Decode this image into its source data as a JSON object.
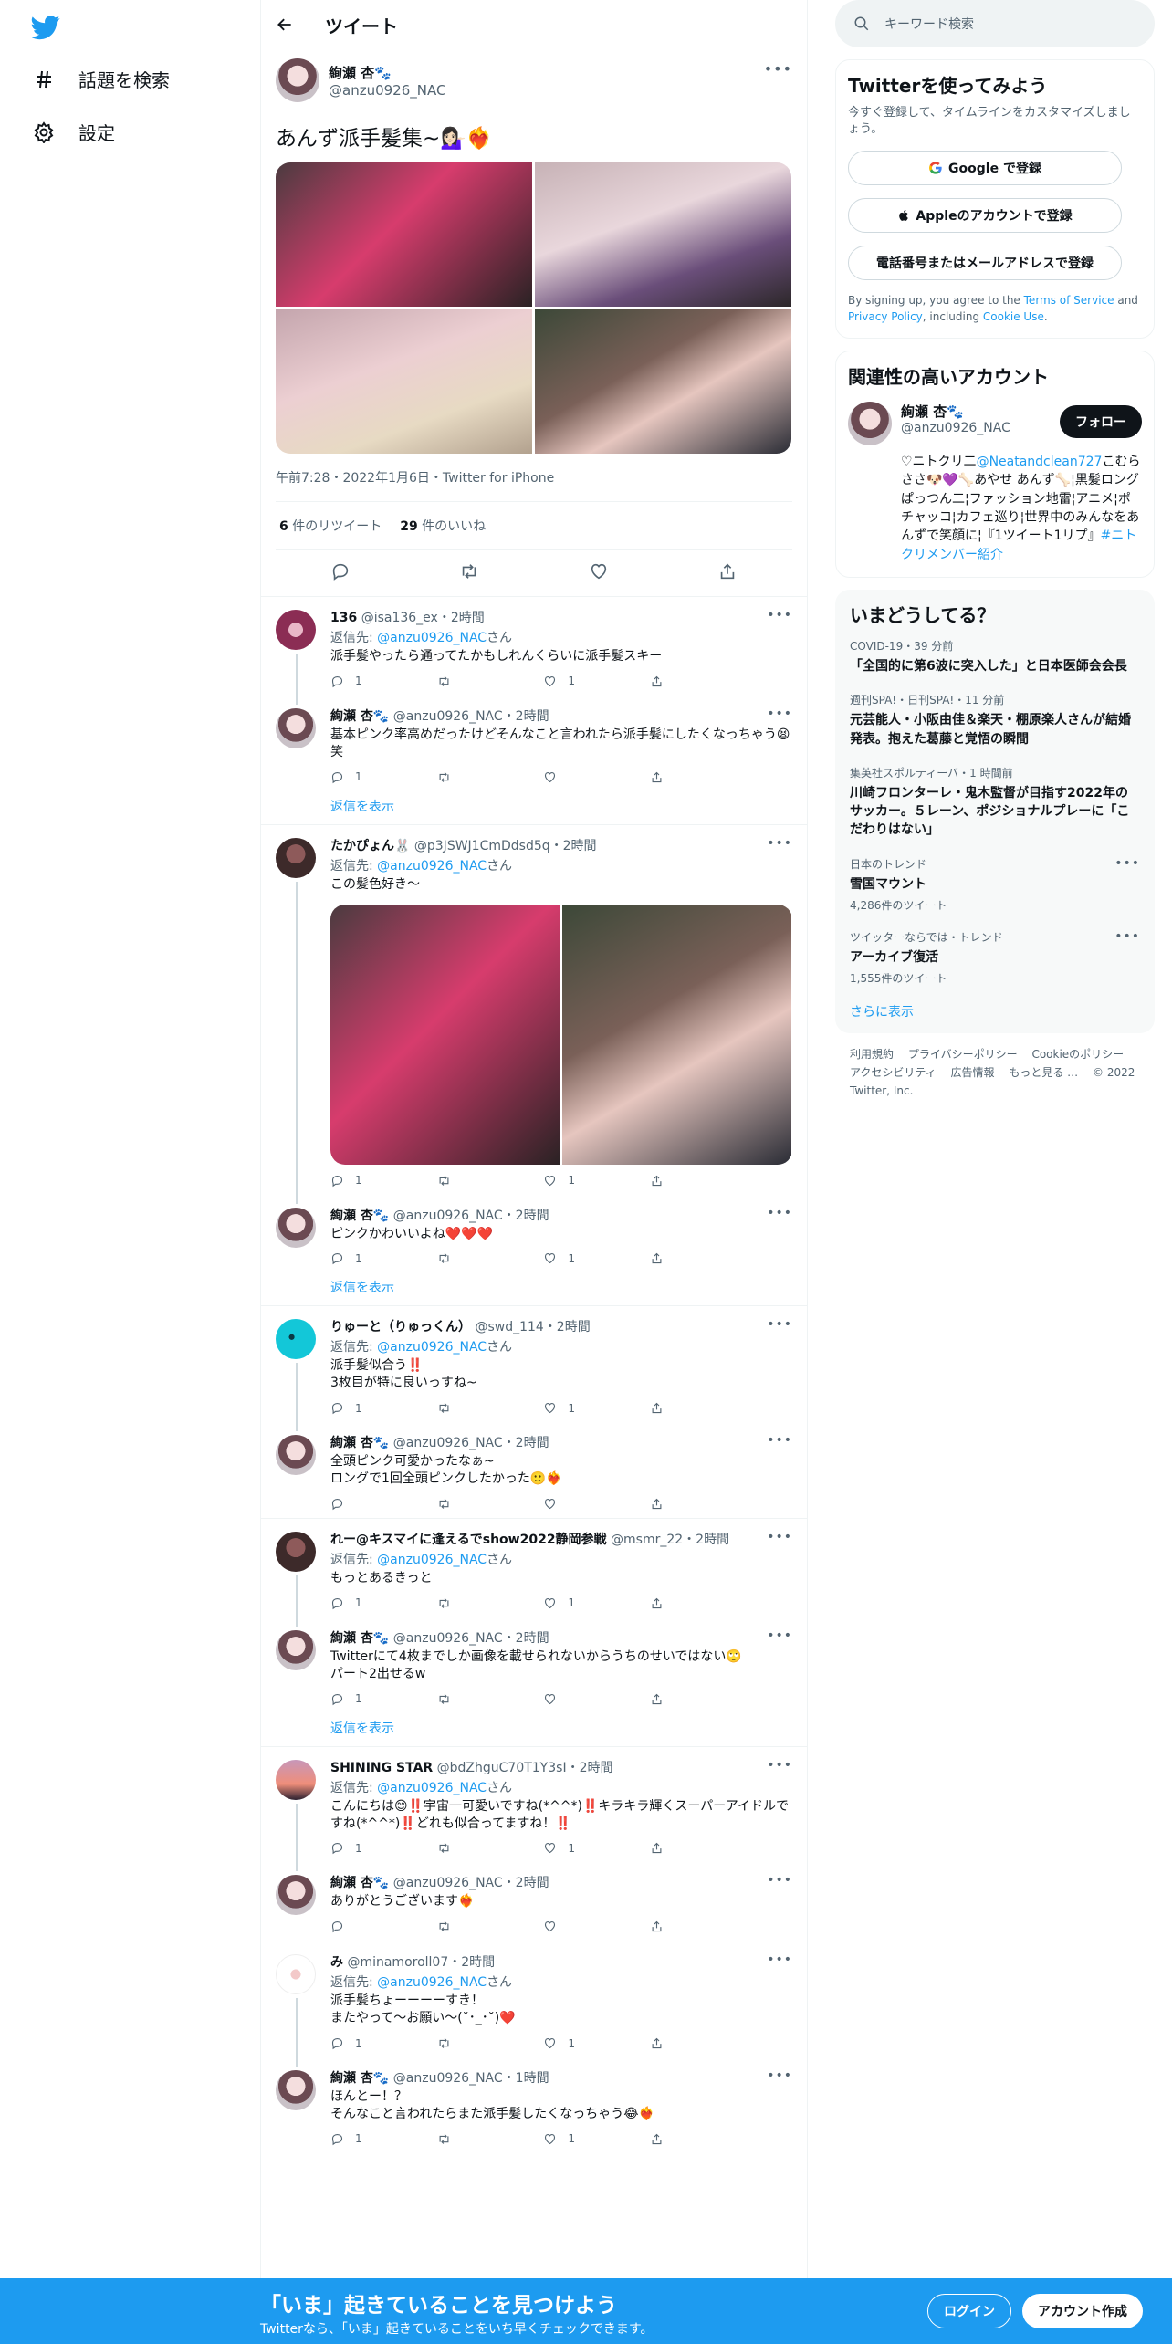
{
  "nav": {
    "explore": "話題を検索",
    "settings": "設定"
  },
  "header": {
    "title": "ツイート"
  },
  "main_tweet": {
    "name": "絢瀬 杏🐾",
    "handle": "@anzu0926_NAC",
    "text": "あんず派手髪集~💁🏻‍♀️❤️‍🔥",
    "meta": "午前7:28・2022年1月6日・Twitter for iPhone",
    "retweets_count": "6",
    "retweets_label": "件のリツイート",
    "likes_count": "29",
    "likes_label": "件のいいね"
  },
  "replies": [
    {
      "name": "136",
      "handle": "@isa136_ex",
      "time": "・2時間",
      "replyto_prefix": "返信先: ",
      "replyto": "@anzu0926_NAC",
      "replyto_suffix": "さん",
      "text": "派手髪やったら通ってたかもしれんくらいに派手髪スキー",
      "rt": "",
      "reply": "1",
      "like": "1"
    },
    {
      "name": "絢瀬 杏🐾",
      "handle": "@anzu0926_NAC",
      "time": "・2時間",
      "text": "基本ピンク率高めだったけどそんなこと言われたら派手髪にしたくなっちゃう😫笑",
      "reply": "1",
      "like": ""
    },
    {
      "name": "たかぴょん🐰",
      "handle": "@p3JSWJ1CmDdsd5q",
      "time": "・2時間",
      "replyto_prefix": "返信先: ",
      "replyto": "@anzu0926_NAC",
      "replyto_suffix": "さん",
      "text": "この髪色好き〜",
      "reply": "1",
      "like": "1"
    },
    {
      "name": "絢瀬 杏🐾",
      "handle": "@anzu0926_NAC",
      "time": "・2時間",
      "text": "ピンクかわいいよね❤️❤️❤️",
      "reply": "1",
      "like": "1"
    },
    {
      "name": "りゅーと（りゅっくん）",
      "handle": "@swd_114",
      "time": "・2時間",
      "replyto_prefix": "返信先: ",
      "replyto": "@anzu0926_NAC",
      "replyto_suffix": "さん",
      "text": "派手髪似合う‼️\n3枚目が特に良いっすね~",
      "reply": "1",
      "like": "1"
    },
    {
      "name": "絢瀬 杏🐾",
      "handle": "@anzu0926_NAC",
      "time": "・2時間",
      "text": "全頭ピンク可愛かったなぁ~\nロングで1回全頭ピンクしたかった🙂❤️‍🔥",
      "reply": "",
      "like": ""
    },
    {
      "name": "れー@キスマイに逢えるでshow2022静岡参戦",
      "handle": "@msmr_22",
      "time": "・2時間",
      "replyto_prefix": "返信先: ",
      "replyto": "@anzu0926_NAC",
      "replyto_suffix": "さん",
      "text": "もっとあるきっと",
      "reply": "1",
      "like": "1"
    },
    {
      "name": "絢瀬 杏🐾",
      "handle": "@anzu0926_NAC",
      "time": "・2時間",
      "text": "Twitterにて4枚までしか画像を載せられないからうちのせいではない🙄\nパート2出せるw",
      "reply": "1",
      "like": ""
    },
    {
      "name": "SHINING STAR",
      "handle": "@bdZhguC70T1Y3sI",
      "time": "・2時間",
      "replyto_prefix": "返信先: ",
      "replyto": "@anzu0926_NAC",
      "replyto_suffix": "さん",
      "text": "こんにちは😊‼️宇宙一可愛いですね(*^^*)‼️キラキラ輝くスーパーアイドルですね(*^^*)‼️どれも似合ってますね！‼️",
      "reply": "1",
      "like": "1"
    },
    {
      "name": "絢瀬 杏🐾",
      "handle": "@anzu0926_NAC",
      "time": "・2時間",
      "text": "ありがとうございます❤️‍🔥",
      "reply": "",
      "like": ""
    },
    {
      "name": "み",
      "handle": "@minamoroll07",
      "time": "・2時間",
      "replyto_prefix": "返信先: ",
      "replyto": "@anzu0926_NAC",
      "replyto_suffix": "さん",
      "text": "派手髪ちょーーーーすき！\nまたやって〜お願い〜(˘･_･˘)❤️",
      "reply": "1",
      "like": "1"
    },
    {
      "name": "絢瀬 杏🐾",
      "handle": "@anzu0926_NAC",
      "time": "・1時間",
      "text": "ほんとー！？\nそんなこと言われたらまた派手髪したくなっちゃう😂❤️‍🔥",
      "reply": "1",
      "like": "1"
    }
  ],
  "show_replies": "返信を表示",
  "right": {
    "search_placeholder": "キーワード検索",
    "signup_title": "Twitterを使ってみよう",
    "signup_sub": "今すぐ登録して、タイムラインをカスタマイズしましょう。",
    "google_btn": "Google で登録",
    "apple_btn": "Appleのアカウントで登録",
    "phone_btn": "電話番号またはメールアドレスで登録",
    "legal_1": "By signing up, you agree to the ",
    "legal_terms": "Terms of Service",
    "legal_2": " and ",
    "legal_privacy": "Privacy Policy",
    "legal_3": ", including ",
    "legal_cookie": "Cookie Use",
    "legal_4": ".",
    "related_title": "関連性の高いアカウント",
    "related_name": "絢瀬 杏🐾",
    "related_handle": "@anzu0926_NAC",
    "follow": "フォロー",
    "bio_1": "♡ニトクリ二",
    "bio_link": "@Neatandclean727",
    "bio_2": "こむらささ🐶💜🦴あやせ あんず🦴¦黒髪ロングぱっつん二¦ファッション地雷¦アニメ¦ポチャッコ¦カフェ巡り¦世界中のみんなをあんずで笑顔に¦『1ツイート1リプ』",
    "bio_tag": "#ニトクリメンバー紹介",
    "trends_title": "いまどうしてる？",
    "trends": [
      {
        "src": "COVID-19・39 分前",
        "title": "「全国的に第6波に突入した」と日本医師会会長"
      },
      {
        "src": "週刊SPA!・日刊SPA!・11 分前",
        "title": "元芸能人・小阪由佳＆楽天・棚原楽人さんが結婚発表。抱えた葛藤と覚悟の瞬間"
      },
      {
        "src": "集英社スポルティーバ・1 時間前",
        "title": "川崎フロンターレ・鬼木監督が目指す2022年のサッカー。５レーン、ポジショナルプレーに「こだわりはない」"
      },
      {
        "src": "日本のトレンド",
        "title": "雪国マウント",
        "count": "4,286件のツイート"
      },
      {
        "src": "ツイッターならでは・トレンド",
        "title": "アーカイブ復活",
        "count": "1,555件のツイート"
      }
    ],
    "show_more": "さらに表示",
    "footer": [
      "利用規約",
      "プライバシーポリシー",
      "Cookieのポリシー",
      "アクセシビリティ",
      "広告情報",
      "もっと見る …",
      "© 2022 Twitter, Inc."
    ]
  },
  "bottom": {
    "title": "「いま」起きていることを見つけよう",
    "sub": "Twitterなら、「いま」起きていることをいち早くチェックできます。",
    "login": "ログイン",
    "signup": "アカウント作成"
  }
}
